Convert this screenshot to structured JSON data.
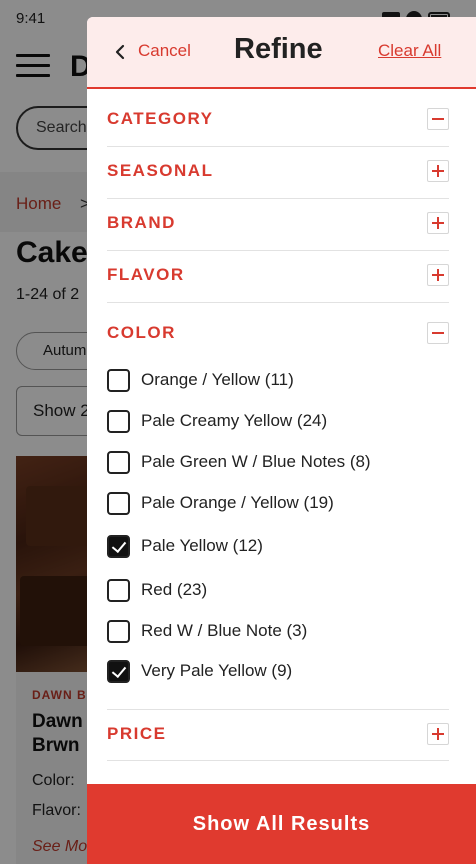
{
  "status_bar": {
    "time": "9:41"
  },
  "background_page": {
    "logo_letter": "D",
    "search_placeholder": "Search",
    "breadcrumb": {
      "home": "Home",
      "separator": ">"
    },
    "title": "Cake",
    "result_count": "1-24 of 2",
    "chip": "Autum",
    "show_select": "Show 2",
    "product": {
      "brand": "DAWN B",
      "name": "Dawn Brwn",
      "color_label": "Color:",
      "flavor_label": "Flavor:",
      "see_more": "See Mo"
    }
  },
  "drawer": {
    "cancel_label": "Cancel",
    "title": "Refine",
    "clear_all": "Clear All",
    "sections": {
      "category": {
        "label": "CATEGORY",
        "expanded": true
      },
      "seasonal": {
        "label": "SEASONAL",
        "expanded": false
      },
      "brand": {
        "label": "BRAND",
        "expanded": false
      },
      "flavor": {
        "label": "FLAVOR",
        "expanded": false
      },
      "color": {
        "label": "COLOR",
        "expanded": true
      },
      "price": {
        "label": "PRICE",
        "expanded": false
      }
    },
    "color_options": [
      {
        "label": "Orange / Yellow (11)",
        "checked": false
      },
      {
        "label": "Pale Creamy Yellow (24)",
        "checked": false
      },
      {
        "label": "Pale Green W / Blue Notes (8)",
        "checked": false
      },
      {
        "label": "Pale Orange / Yellow (19)",
        "checked": false
      },
      {
        "label": "Pale Yellow (12)",
        "checked": true
      },
      {
        "label": "Red (23)",
        "checked": false
      },
      {
        "label": "Red W / Blue Note (3)",
        "checked": false
      },
      {
        "label": "Very Pale Yellow (9)",
        "checked": true
      }
    ],
    "show_results_label": "Show All Results"
  },
  "colors": {
    "accent": "#e03a2f",
    "header_bg": "#fdeceb",
    "text": "#222222"
  }
}
